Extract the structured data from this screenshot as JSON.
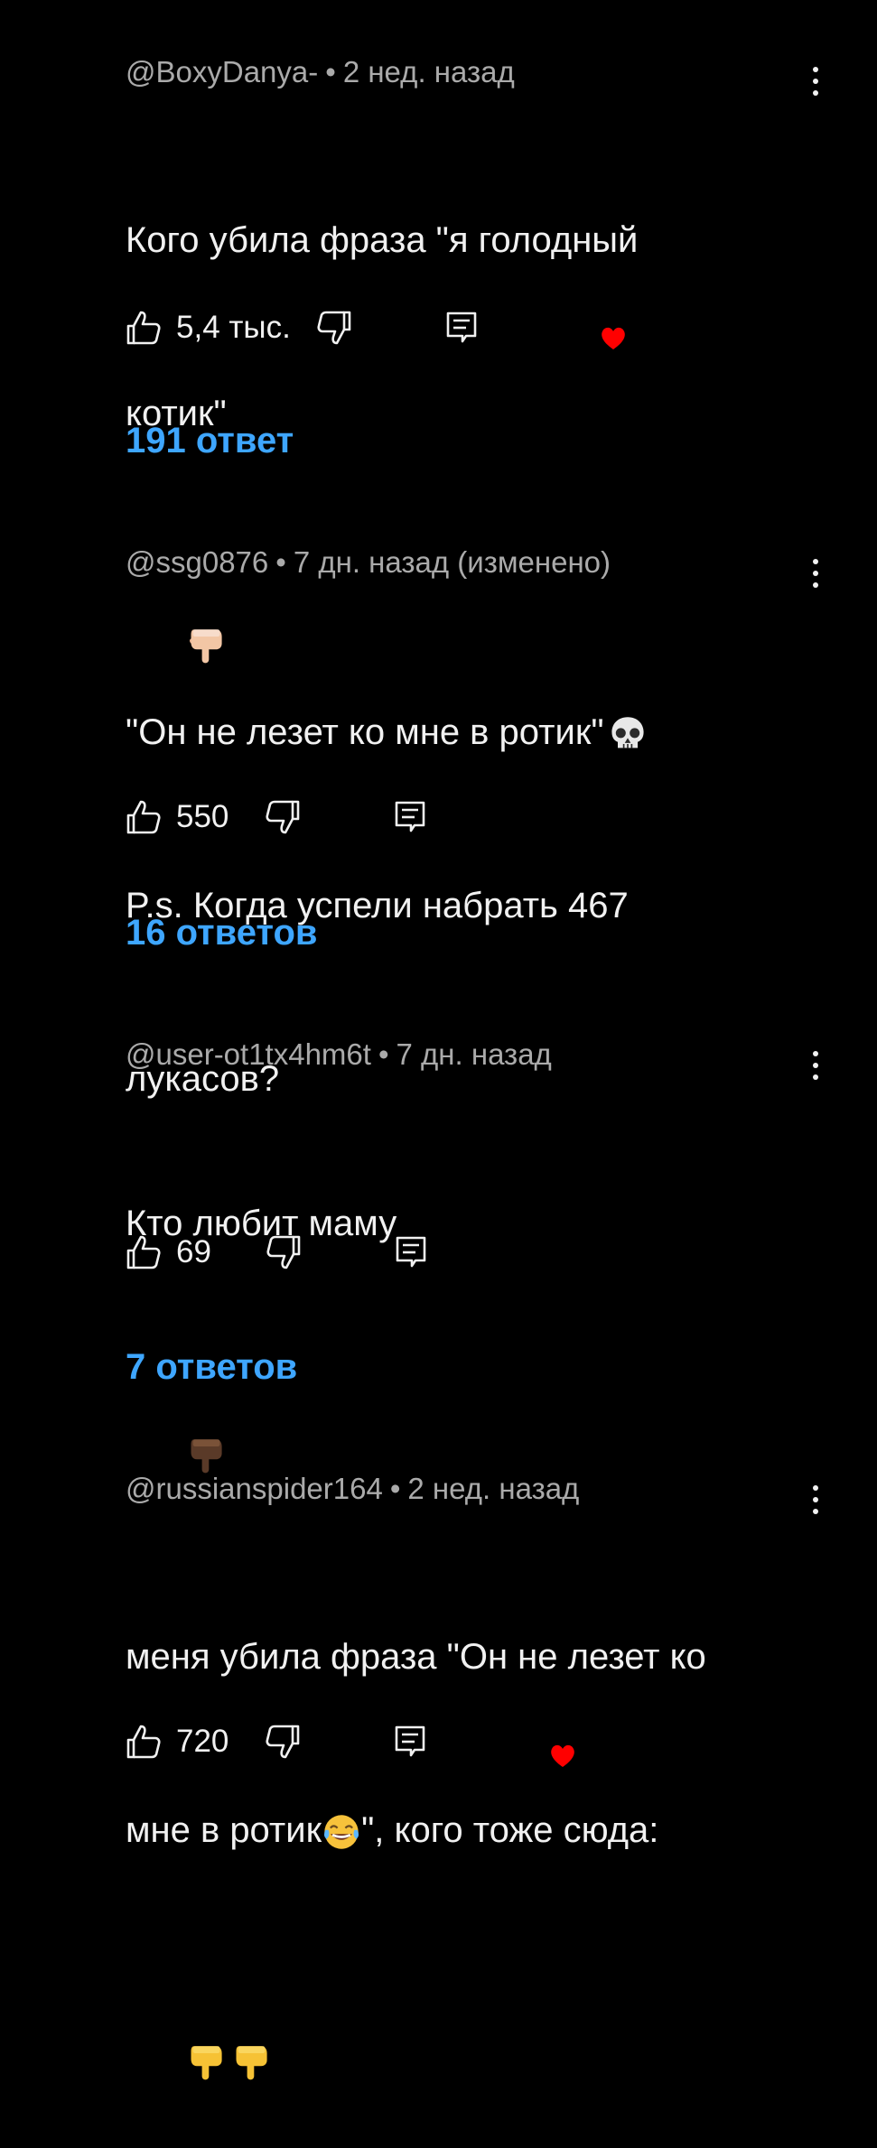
{
  "comments": [
    {
      "author": "@BoxyDanya-",
      "time": "2 нед. назад",
      "text_line1": "Кого убила фраза \"я голодный",
      "text_line2": "котик\"",
      "emoji_name": "hand-pointing-down",
      "likes": "5,4 тыс.",
      "replies": "191 ответ",
      "has_heart": true
    },
    {
      "author": "@ssg0876",
      "time": "7 дн. назад (изменено)",
      "text_line1": "\"Он не лезет ко мне в ротик\"",
      "text_line2": "P.s. Когда успели набрать 467",
      "text_line3": "лукасов?",
      "emoji_name": "skull",
      "likes": "550",
      "replies": "16 ответов",
      "has_heart": false
    },
    {
      "author": "@user-ot1tx4hm6t",
      "time": "7 дн. назад",
      "text_line1": "Кто любит маму",
      "emoji_name": "hand-pointing-down-dark",
      "likes": "69",
      "replies": "7 ответов",
      "has_heart": false
    },
    {
      "author": "@russianspider164",
      "time": "2 нед. назад",
      "text_line1": "меня убила фраза \"Он не лезет ко",
      "text_line2_a": "мне в ротик",
      "text_line2_b": "\", кого тоже сюда:",
      "emoji_name": "face-with-tears-of-joy",
      "likes": "720",
      "has_heart": true
    }
  ],
  "colors": {
    "background": "#000000",
    "meta": "#aaaaaa",
    "text": "#f1f1f1",
    "link": "#3ea6ff",
    "heart": "#ff0000"
  }
}
